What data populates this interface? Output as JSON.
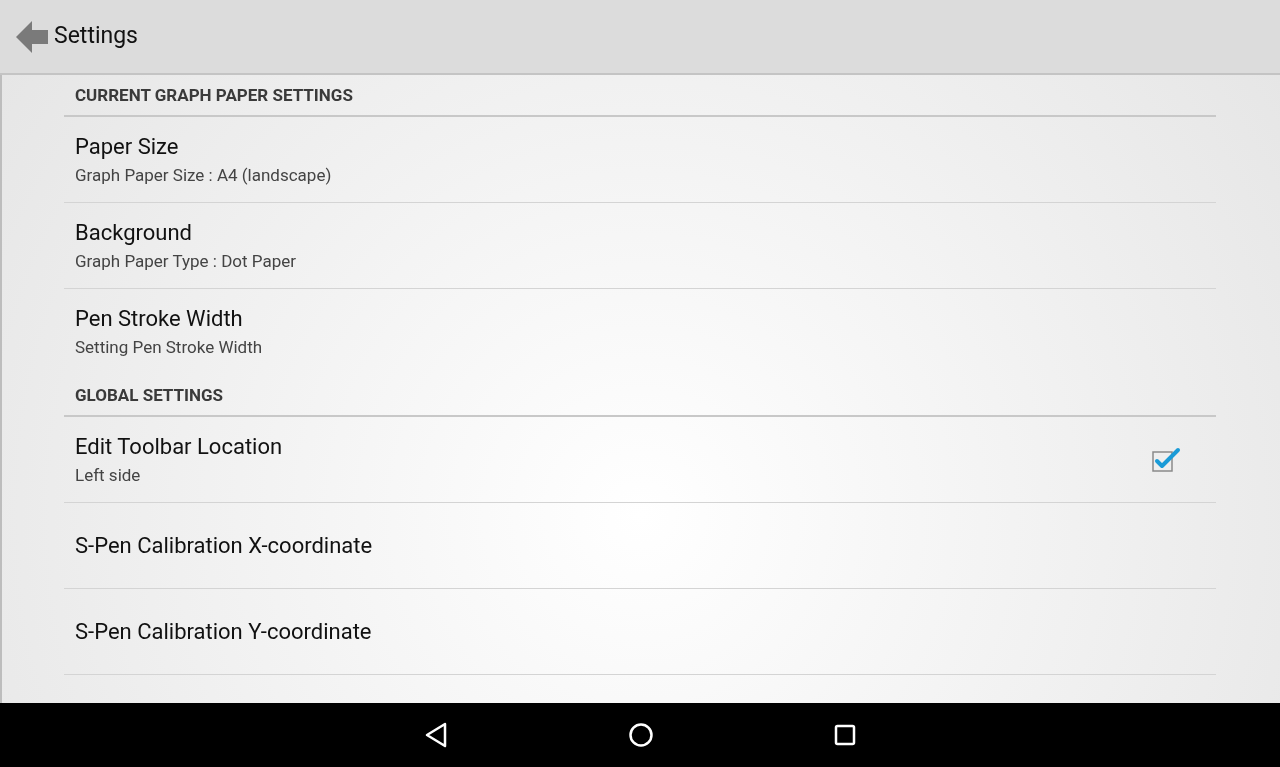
{
  "app_bar": {
    "title": "Settings"
  },
  "sections": [
    {
      "header": "CURRENT GRAPH PAPER SETTINGS",
      "items": [
        {
          "kind": "text",
          "title": "Paper Size",
          "summary": "Graph Paper Size : A4 (landscape)"
        },
        {
          "kind": "text",
          "title": "Background",
          "summary": "Graph Paper Type : Dot Paper"
        },
        {
          "kind": "text",
          "title": "Pen Stroke Width",
          "summary": "Setting Pen Stroke Width"
        }
      ]
    },
    {
      "header": "GLOBAL SETTINGS",
      "items": [
        {
          "kind": "checkbox",
          "title": "Edit Toolbar Location",
          "summary": "Left side",
          "checked": true
        },
        {
          "kind": "text",
          "title": "S-Pen Calibration X-coordinate"
        },
        {
          "kind": "text",
          "title": "S-Pen Calibration Y-coordinate"
        }
      ]
    }
  ]
}
